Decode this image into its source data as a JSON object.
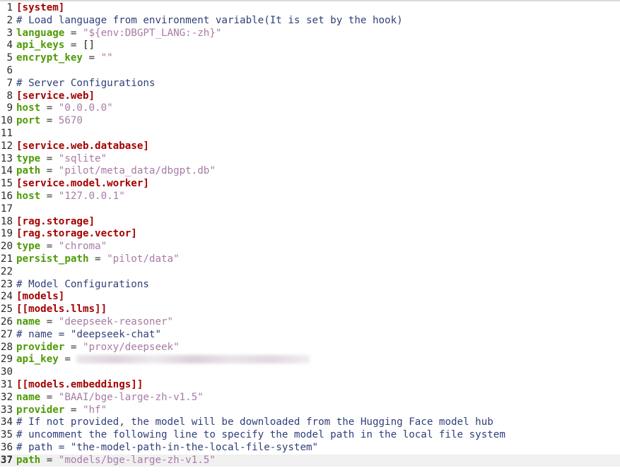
{
  "editor": {
    "current_line": 37,
    "lines": [
      {
        "n": "1",
        "tokens": [
          {
            "t": "section",
            "v": "[system]"
          }
        ]
      },
      {
        "n": "2",
        "tokens": [
          {
            "t": "comment",
            "v": "# Load language from environment variable(It is set by the hook)"
          }
        ]
      },
      {
        "n": "3",
        "tokens": [
          {
            "t": "key",
            "v": "language"
          },
          {
            "t": "op",
            "v": " = "
          },
          {
            "t": "str",
            "v": "\"${env:DBGPT_LANG:-zh}\""
          }
        ]
      },
      {
        "n": "4",
        "tokens": [
          {
            "t": "key",
            "v": "api_keys"
          },
          {
            "t": "op",
            "v": " = "
          },
          {
            "t": "plain",
            "v": "[]"
          }
        ]
      },
      {
        "n": "5",
        "tokens": [
          {
            "t": "key",
            "v": "encrypt_key"
          },
          {
            "t": "op",
            "v": " = "
          },
          {
            "t": "str",
            "v": "\"\""
          }
        ]
      },
      {
        "n": "6",
        "tokens": []
      },
      {
        "n": "7",
        "tokens": [
          {
            "t": "comment",
            "v": "# Server Configurations"
          }
        ]
      },
      {
        "n": "8",
        "tokens": [
          {
            "t": "section",
            "v": "[service.web]"
          }
        ]
      },
      {
        "n": "9",
        "tokens": [
          {
            "t": "key",
            "v": "host"
          },
          {
            "t": "op",
            "v": " = "
          },
          {
            "t": "str",
            "v": "\"0.0.0.0\""
          }
        ]
      },
      {
        "n": "10",
        "tokens": [
          {
            "t": "key",
            "v": "port"
          },
          {
            "t": "op",
            "v": " = "
          },
          {
            "t": "num",
            "v": "5670"
          }
        ]
      },
      {
        "n": "11",
        "tokens": []
      },
      {
        "n": "12",
        "tokens": [
          {
            "t": "section",
            "v": "[service.web.database]"
          }
        ]
      },
      {
        "n": "13",
        "tokens": [
          {
            "t": "key",
            "v": "type"
          },
          {
            "t": "op",
            "v": " = "
          },
          {
            "t": "str",
            "v": "\"sqlite\""
          }
        ]
      },
      {
        "n": "14",
        "tokens": [
          {
            "t": "key",
            "v": "path"
          },
          {
            "t": "op",
            "v": " = "
          },
          {
            "t": "str",
            "v": "\"pilot/meta_data/dbgpt.db\""
          }
        ]
      },
      {
        "n": "15",
        "tokens": [
          {
            "t": "section",
            "v": "[service.model.worker]"
          }
        ]
      },
      {
        "n": "16",
        "tokens": [
          {
            "t": "key",
            "v": "host"
          },
          {
            "t": "op",
            "v": " = "
          },
          {
            "t": "str",
            "v": "\"127.0.0.1\""
          }
        ]
      },
      {
        "n": "17",
        "tokens": []
      },
      {
        "n": "18",
        "tokens": [
          {
            "t": "section",
            "v": "[rag.storage]"
          }
        ]
      },
      {
        "n": "19",
        "tokens": [
          {
            "t": "section",
            "v": "[rag.storage.vector]"
          }
        ]
      },
      {
        "n": "20",
        "tokens": [
          {
            "t": "key",
            "v": "type"
          },
          {
            "t": "op",
            "v": " = "
          },
          {
            "t": "str",
            "v": "\"chroma\""
          }
        ]
      },
      {
        "n": "21",
        "tokens": [
          {
            "t": "key",
            "v": "persist_path"
          },
          {
            "t": "op",
            "v": " = "
          },
          {
            "t": "str",
            "v": "\"pilot/data\""
          }
        ]
      },
      {
        "n": "22",
        "tokens": []
      },
      {
        "n": "23",
        "tokens": [
          {
            "t": "comment",
            "v": "# Model Configurations"
          }
        ]
      },
      {
        "n": "24",
        "tokens": [
          {
            "t": "section",
            "v": "[models]"
          }
        ]
      },
      {
        "n": "25",
        "tokens": [
          {
            "t": "section",
            "v": "[[models.llms]]"
          }
        ]
      },
      {
        "n": "26",
        "tokens": [
          {
            "t": "key",
            "v": "name"
          },
          {
            "t": "op",
            "v": " = "
          },
          {
            "t": "str",
            "v": "\"deepseek-reasoner\""
          }
        ]
      },
      {
        "n": "27",
        "tokens": [
          {
            "t": "comment",
            "v": "# name = \"deepseek-chat\""
          }
        ]
      },
      {
        "n": "28",
        "tokens": [
          {
            "t": "key",
            "v": "provider"
          },
          {
            "t": "op",
            "v": " = "
          },
          {
            "t": "str",
            "v": "\"proxy/deepseek\""
          }
        ]
      },
      {
        "n": "29",
        "tokens": [
          {
            "t": "key",
            "v": "api_key"
          },
          {
            "t": "op",
            "v": " = "
          },
          {
            "t": "redacted",
            "v": ""
          }
        ]
      },
      {
        "n": "30",
        "tokens": []
      },
      {
        "n": "31",
        "tokens": [
          {
            "t": "section",
            "v": "[[models.embeddings]]"
          }
        ]
      },
      {
        "n": "32",
        "tokens": [
          {
            "t": "key",
            "v": "name"
          },
          {
            "t": "op",
            "v": " = "
          },
          {
            "t": "str",
            "v": "\"BAAI/bge-large-zh-v1.5\""
          }
        ]
      },
      {
        "n": "33",
        "tokens": [
          {
            "t": "key",
            "v": "provider"
          },
          {
            "t": "op",
            "v": " = "
          },
          {
            "t": "str",
            "v": "\"hf\""
          }
        ]
      },
      {
        "n": "34",
        "tokens": [
          {
            "t": "comment",
            "v": "# If not provided, the model will be downloaded from the Hugging Face model hub"
          }
        ]
      },
      {
        "n": "35",
        "tokens": [
          {
            "t": "comment",
            "v": "# uncomment the following line to specify the model path in the local file system"
          }
        ]
      },
      {
        "n": "36",
        "tokens": [
          {
            "t": "comment",
            "v": "# path = \"the-model-path-in-the-local-file-system\""
          }
        ]
      },
      {
        "n": "37",
        "tokens": [
          {
            "t": "key",
            "v": "path"
          },
          {
            "t": "op",
            "v": " = "
          },
          {
            "t": "str",
            "v": "\"models/bge-large-zh-v1.5\""
          }
        ]
      }
    ]
  },
  "colors": {
    "section": "#a40000",
    "key": "#4e9a06",
    "string": "#a77ba5",
    "comment": "#2f3f7a",
    "current_line_bg": "#f0f0f0"
  }
}
